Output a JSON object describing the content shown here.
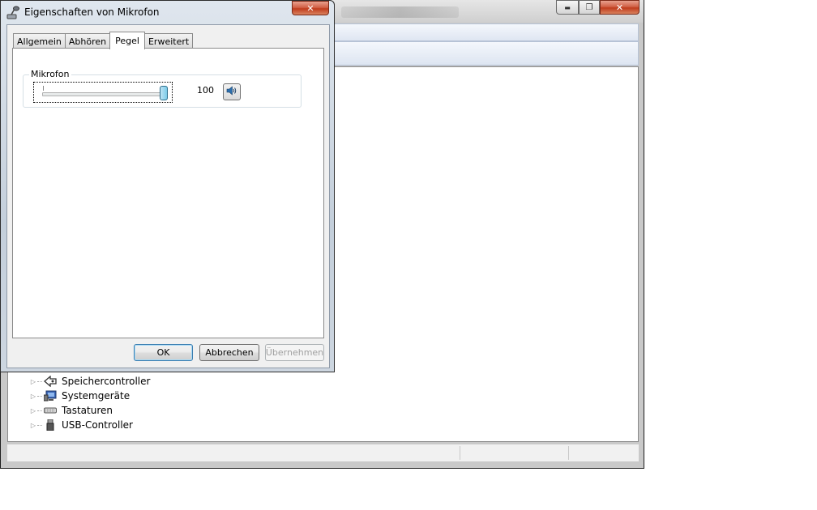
{
  "background_window": {
    "tree_items": [
      {
        "label": "Speichercontroller",
        "icon": "storage-controller-icon"
      },
      {
        "label": "Systemgeräte",
        "icon": "system-devices-icon"
      },
      {
        "label": "Tastaturen",
        "icon": "keyboard-icon"
      },
      {
        "label": "USB-Controller",
        "icon": "usb-icon"
      }
    ],
    "caption_buttons": {
      "minimize": "▬",
      "maximize": "❐",
      "close": "✕"
    }
  },
  "dialog": {
    "title": "Eigenschaften von Mikrofon",
    "close_glyph": "✕",
    "tabs": [
      {
        "label": "Allgemein",
        "active": false
      },
      {
        "label": "Abhören",
        "active": false
      },
      {
        "label": "Pegel",
        "active": true
      },
      {
        "label": "Erweitert",
        "active": false
      }
    ],
    "level_group": {
      "label": "Mikrofon",
      "value": "100",
      "slider_fraction": 1.0,
      "mute_icon": "speaker-icon"
    },
    "buttons": {
      "ok": "OK",
      "cancel": "Abbrechen",
      "apply": "Übernehmen"
    }
  },
  "colors": {
    "close_red": "#c03c1d",
    "slider_thumb": "#7ccbe8",
    "toolbar_blue": "#dfe6f2"
  }
}
